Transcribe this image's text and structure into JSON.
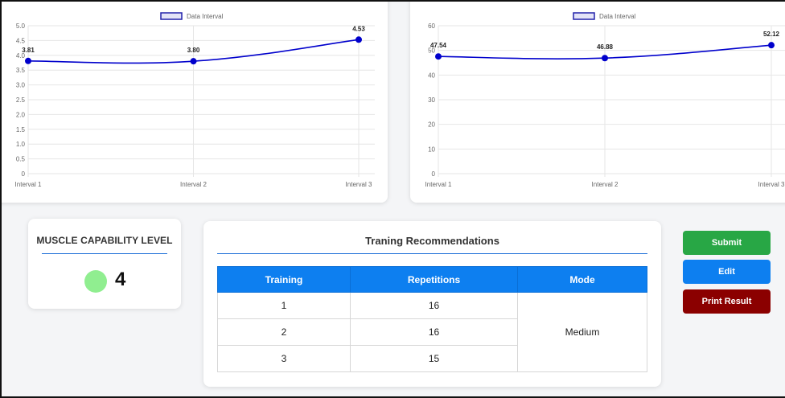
{
  "chart_data": [
    {
      "type": "line",
      "legend": "Data Interval",
      "categories": [
        "Interval 1",
        "Interval 2",
        "Interval 3"
      ],
      "values": [
        3.81,
        3.8,
        4.53
      ],
      "value_labels": [
        "3.81",
        "3.80",
        "4.53"
      ],
      "ylim": [
        0,
        5
      ],
      "yticks": [
        "0",
        "0.5",
        "1.0",
        "1.5",
        "2.0",
        "2.5",
        "3.0",
        "3.5",
        "4.0",
        "4.5",
        "5.0"
      ],
      "color": "#0000cc",
      "legend_placement": "top-center",
      "grid": true
    },
    {
      "type": "line",
      "legend": "Data Interval",
      "categories": [
        "Interval 1",
        "Interval 2",
        "Interval 3"
      ],
      "values": [
        47.54,
        46.88,
        52.12
      ],
      "value_labels": [
        "47.54",
        "46.88",
        "52.12"
      ],
      "ylim": [
        0,
        60
      ],
      "yticks": [
        "0",
        "10",
        "20",
        "30",
        "40",
        "50",
        "60"
      ],
      "color": "#0000cc",
      "legend_placement": "top-center",
      "grid": true
    }
  ],
  "capability": {
    "title": "MUSCLE CAPABILITY LEVEL",
    "level": "4",
    "indicator_color": "#90ee90"
  },
  "training": {
    "title": "Traning Recommendations",
    "headers": [
      "Training",
      "Repetitions",
      "Mode"
    ],
    "rows": [
      {
        "training": "1",
        "repetitions": "16"
      },
      {
        "training": "2",
        "repetitions": "16"
      },
      {
        "training": "3",
        "repetitions": "15"
      }
    ],
    "mode": "Medium"
  },
  "buttons": {
    "submit": "Submit",
    "edit": "Edit",
    "print": "Print Result"
  },
  "colors": {
    "submit": "#28a745",
    "edit": "#0d7ff0",
    "print": "#8b0000",
    "table_header": "#0d7ff0"
  }
}
